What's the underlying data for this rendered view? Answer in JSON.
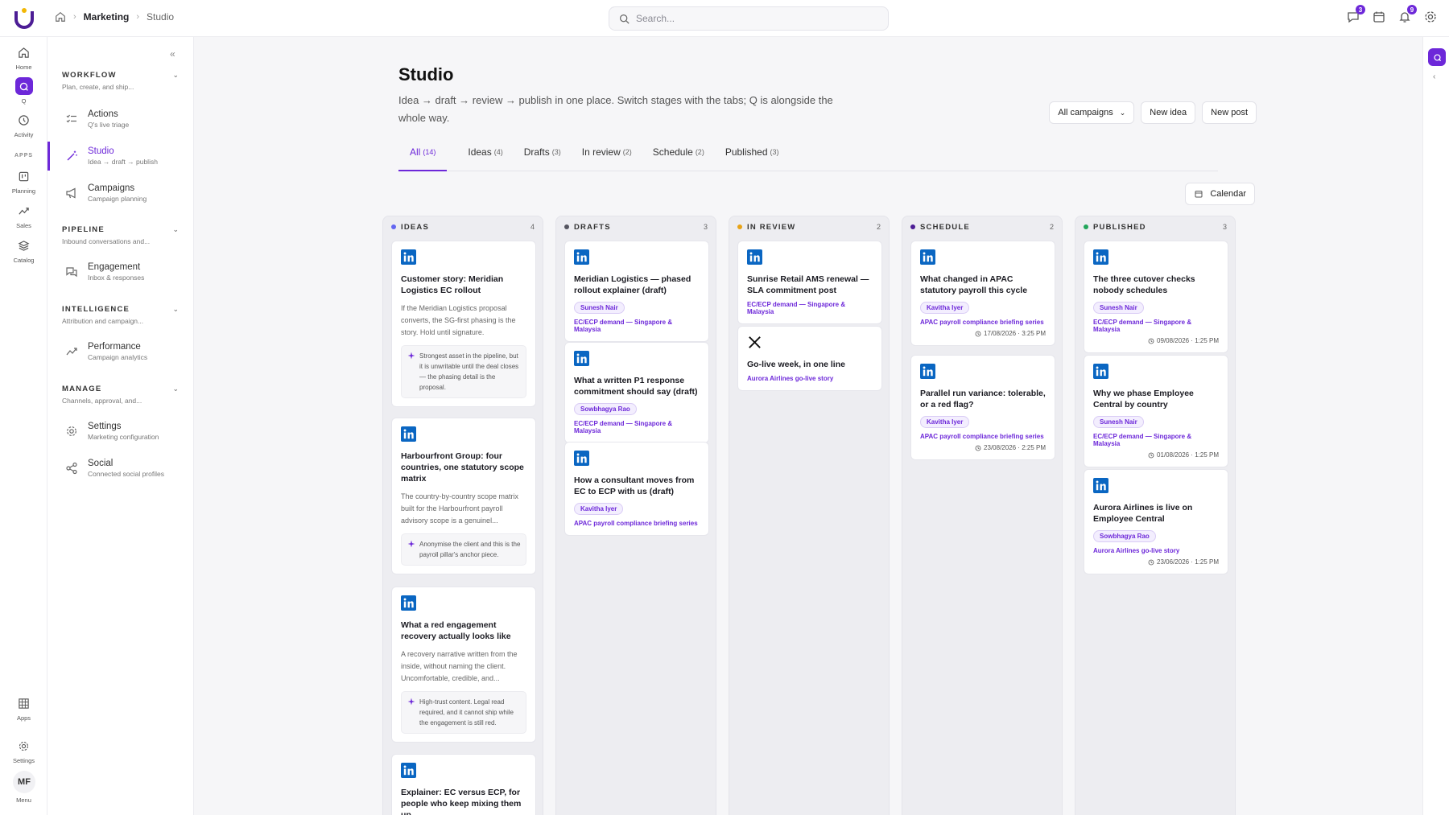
{
  "header": {
    "breadcrumb": [
      "Marketing",
      "Studio"
    ],
    "search_placeholder": "Search...",
    "messages_badge": "3",
    "notifications_badge": "9"
  },
  "rail": {
    "items": [
      {
        "label": "Home",
        "icon": "home-icon"
      },
      {
        "label": "Q",
        "icon": "q-icon"
      },
      {
        "label": "Activity",
        "icon": "history-icon"
      },
      {
        "label": "Planning",
        "icon": "planning-icon"
      },
      {
        "label": "Sales",
        "icon": "trend-icon"
      },
      {
        "label": "Catalog",
        "icon": "layers-icon"
      }
    ],
    "apps_section": "APPS",
    "bottom": [
      {
        "label": "Apps",
        "icon": "grid-icon"
      },
      {
        "label": "Settings",
        "icon": "gear-icon"
      }
    ],
    "avatar_initials": "MF",
    "avatar_label": "Menu"
  },
  "sidebar": {
    "sections": [
      {
        "title": "WORKFLOW",
        "sub": "Plan, create, and ship...",
        "items": [
          {
            "title": "Actions",
            "sub": "Q's live triage"
          },
          {
            "title": "Studio",
            "sub": "Idea → draft → publish"
          },
          {
            "title": "Campaigns",
            "sub": "Campaign planning"
          }
        ]
      },
      {
        "title": "PIPELINE",
        "sub": "Inbound conversations and...",
        "items": [
          {
            "title": "Engagement",
            "sub": "Inbox & responses"
          }
        ]
      },
      {
        "title": "INTELLIGENCE",
        "sub": "Attribution and campaign...",
        "items": [
          {
            "title": "Performance",
            "sub": "Campaign analytics"
          }
        ]
      },
      {
        "title": "MANAGE",
        "sub": "Channels, approval, and...",
        "items": [
          {
            "title": "Settings",
            "sub": "Marketing configuration"
          },
          {
            "title": "Social",
            "sub": "Connected social profiles"
          }
        ]
      }
    ]
  },
  "page": {
    "title": "Studio",
    "description": "Idea → draft → review → publish in one place. Switch stages with the tabs; Q is alongside the whole way.",
    "campaign_filter": "All campaigns",
    "new_idea": "New idea",
    "new_post": "New post",
    "calendar": "Calendar",
    "tabs": [
      {
        "label": "All",
        "count": "(14)"
      },
      {
        "label": "Ideas",
        "count": "(4)"
      },
      {
        "label": "Drafts",
        "count": "(3)"
      },
      {
        "label": "In review",
        "count": "(2)"
      },
      {
        "label": "Schedule",
        "count": "(2)"
      },
      {
        "label": "Published",
        "count": "(3)"
      }
    ]
  },
  "columns": [
    {
      "title": "IDEAS",
      "count": "4",
      "color": "#6366f1",
      "cards": [
        {
          "platform": "linkedin",
          "title": "Customer story: Meridian Logistics EC rollout",
          "body": "If the Meridian Logistics proposal converts, the SG-first phasing is the story. Hold until signature.",
          "note": "Strongest asset in the pipeline, but it is unwritable until the deal closes — the phasing detail is the proposal."
        },
        {
          "platform": "linkedin",
          "title": "Harbourfront Group: four countries, one statutory scope matrix",
          "body": "The country-by-country scope matrix built for the Harbourfront payroll advisory scope is a genuinel...",
          "note": "Anonymise the client and this is the payroll pillar's anchor piece."
        },
        {
          "platform": "linkedin",
          "title": "What a red engagement recovery actually looks like",
          "body": "A recovery narrative written from the inside, without naming the client. Uncomfortable, credible, and...",
          "note": "High-trust content. Legal read required, and it cannot ship while the engagement is still red."
        },
        {
          "platform": "linkedin",
          "title": "Explainer: EC versus ECP, for people who keep mixing them up"
        }
      ]
    },
    {
      "title": "DRAFTS",
      "count": "3",
      "color": "#555560",
      "cards": [
        {
          "platform": "linkedin",
          "title": "Meridian Logistics — phased rollout explainer (draft)",
          "owner": "Sunesh Nair",
          "campaign": "EC/ECP demand — Singapore & Malaysia"
        },
        {
          "platform": "linkedin",
          "title": "What a written P1 response commitment should say (draft)",
          "owner": "Sowbhagya Rao",
          "campaign": "EC/ECP demand — Singapore & Malaysia"
        },
        {
          "platform": "linkedin",
          "title": "How a consultant moves from EC to ECP with us (draft)",
          "owner": "Kavitha Iyer",
          "campaign": "APAC payroll compliance briefing series"
        }
      ]
    },
    {
      "title": "IN REVIEW",
      "count": "2",
      "color": "#e8a317",
      "cards": [
        {
          "platform": "linkedin",
          "title": "Sunrise Retail AMS renewal — SLA commitment post",
          "campaign": "EC/ECP demand — Singapore & Malaysia"
        },
        {
          "platform": "x",
          "title": "Go-live week, in one line",
          "campaign": "Aurora Airlines go-live story"
        }
      ]
    },
    {
      "title": "SCHEDULE",
      "count": "2",
      "color": "#4c1d95",
      "cards": [
        {
          "platform": "linkedin",
          "title": "What changed in APAC statutory payroll this cycle",
          "owner": "Kavitha Iyer",
          "campaign": "APAC payroll compliance briefing series",
          "time": "17/08/2026 · 3:25 PM"
        },
        {
          "platform": "linkedin",
          "title": "Parallel run variance: tolerable, or a red flag?",
          "owner": "Kavitha Iyer",
          "campaign": "APAC payroll compliance briefing series",
          "time": "23/08/2026 · 2:25 PM"
        }
      ]
    },
    {
      "title": "PUBLISHED",
      "count": "3",
      "color": "#22a55a",
      "cards": [
        {
          "platform": "linkedin",
          "title": "The three cutover checks nobody schedules",
          "owner": "Sunesh Nair",
          "campaign": "EC/ECP demand — Singapore & Malaysia",
          "time": "09/08/2026 · 1:25 PM"
        },
        {
          "platform": "linkedin",
          "title": "Why we phase Employee Central by country",
          "owner": "Sunesh Nair",
          "campaign": "EC/ECP demand — Singapore & Malaysia",
          "time": "01/08/2026 · 1:25 PM"
        },
        {
          "platform": "linkedin",
          "title": "Aurora Airlines is live on Employee Central",
          "owner": "Sowbhagya Rao",
          "campaign": "Aurora Airlines go-live story",
          "time": "23/06/2026 · 1:25 PM"
        }
      ]
    }
  ],
  "colors": {
    "accent": "#6d28d9",
    "linkedin": "#0a66c2"
  }
}
